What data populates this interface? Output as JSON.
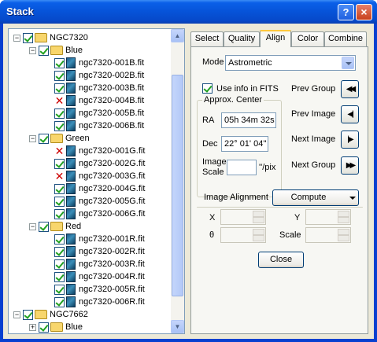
{
  "window": {
    "title": "Stack",
    "help_label": "?",
    "close_label": "×"
  },
  "tree": {
    "rows": [
      {
        "level": 0,
        "expander": "−",
        "checked": true,
        "icon": "folder",
        "label": "NGC7320"
      },
      {
        "level": 1,
        "expander": "−",
        "checked": true,
        "icon": "folder",
        "label": "Blue"
      },
      {
        "level": 2,
        "checked": true,
        "icon": "fits-file",
        "label": "ngc7320-001B.fit"
      },
      {
        "level": 2,
        "checked": true,
        "icon": "fits-file",
        "label": "ngc7320-002B.fit"
      },
      {
        "level": 2,
        "checked": true,
        "icon": "fits-file",
        "label": "ngc7320-003B.fit"
      },
      {
        "level": 2,
        "rejected": true,
        "icon": "fits-file",
        "label": "ngc7320-004B.fit"
      },
      {
        "level": 2,
        "checked": true,
        "icon": "fits-file",
        "label": "ngc7320-005B.fit"
      },
      {
        "level": 2,
        "checked": true,
        "icon": "fits-file",
        "label": "ngc7320-006B.fit"
      },
      {
        "level": 1,
        "expander": "−",
        "checked": true,
        "icon": "folder",
        "label": "Green"
      },
      {
        "level": 2,
        "rejected": true,
        "icon": "fits-file",
        "label": "ngc7320-001G.fit"
      },
      {
        "level": 2,
        "checked": true,
        "icon": "fits-file",
        "label": "ngc7320-002G.fit"
      },
      {
        "level": 2,
        "rejected": true,
        "icon": "fits-file",
        "label": "ngc7320-003G.fit"
      },
      {
        "level": 2,
        "checked": true,
        "icon": "fits-file",
        "label": "ngc7320-004G.fit"
      },
      {
        "level": 2,
        "checked": true,
        "icon": "fits-file",
        "label": "ngc7320-005G.fit"
      },
      {
        "level": 2,
        "checked": true,
        "icon": "fits-file",
        "label": "ngc7320-006G.fit"
      },
      {
        "level": 1,
        "expander": "−",
        "checked": true,
        "icon": "folder",
        "label": "Red"
      },
      {
        "level": 2,
        "checked": true,
        "icon": "fits-file",
        "label": "ngc7320-001R.fit"
      },
      {
        "level": 2,
        "checked": true,
        "icon": "fits-file",
        "label": "ngc7320-002R.fit"
      },
      {
        "level": 2,
        "checked": true,
        "icon": "fits-file",
        "label": "ngc7320-003R.fit"
      },
      {
        "level": 2,
        "checked": true,
        "icon": "fits-file",
        "label": "ngc7320-004R.fit"
      },
      {
        "level": 2,
        "checked": true,
        "icon": "fits-file",
        "label": "ngc7320-005R.fit"
      },
      {
        "level": 2,
        "checked": true,
        "icon": "fits-file",
        "label": "ngc7320-006R.fit"
      },
      {
        "level": 0,
        "expander": "−",
        "checked": true,
        "icon": "folder",
        "label": "NGC7662"
      },
      {
        "level": 1,
        "expander": "+",
        "checked": true,
        "icon": "folder",
        "label": "Blue"
      }
    ]
  },
  "tabs": [
    {
      "label": "Select",
      "active": false
    },
    {
      "label": "Quality",
      "active": false
    },
    {
      "label": "Align",
      "active": true
    },
    {
      "label": "Color",
      "active": false
    },
    {
      "label": "Combine",
      "active": false
    }
  ],
  "align": {
    "mode_label": "Mode",
    "mode_value": "Astrometric",
    "use_fits_label": "Use info in FITS",
    "use_fits_checked": true,
    "approx_center_title": "Approx. Center",
    "ra_label": "RA",
    "ra_value": "05h 34m 32s",
    "dec_label": "Dec",
    "dec_value": "22° 01' 04''",
    "image_scale_label_1": "Image",
    "image_scale_label_2": "Scale",
    "image_scale_value": "",
    "image_scale_unit": "''/pix",
    "prev_group_label": "Prev Group",
    "prev_image_label": "Prev Image",
    "next_image_label": "Next Image",
    "next_group_label": "Next Group",
    "prev_group_glyph": "◀◀",
    "prev_image_glyph": "◀|",
    "next_image_glyph": "|▶",
    "next_group_glyph": "▶▶",
    "image_alignment_label": "Image Alignment",
    "compute_label": "Compute",
    "x_label": "X",
    "y_label": "Y",
    "theta_label": "θ",
    "scale_label": "Scale",
    "close_label": "Close"
  }
}
